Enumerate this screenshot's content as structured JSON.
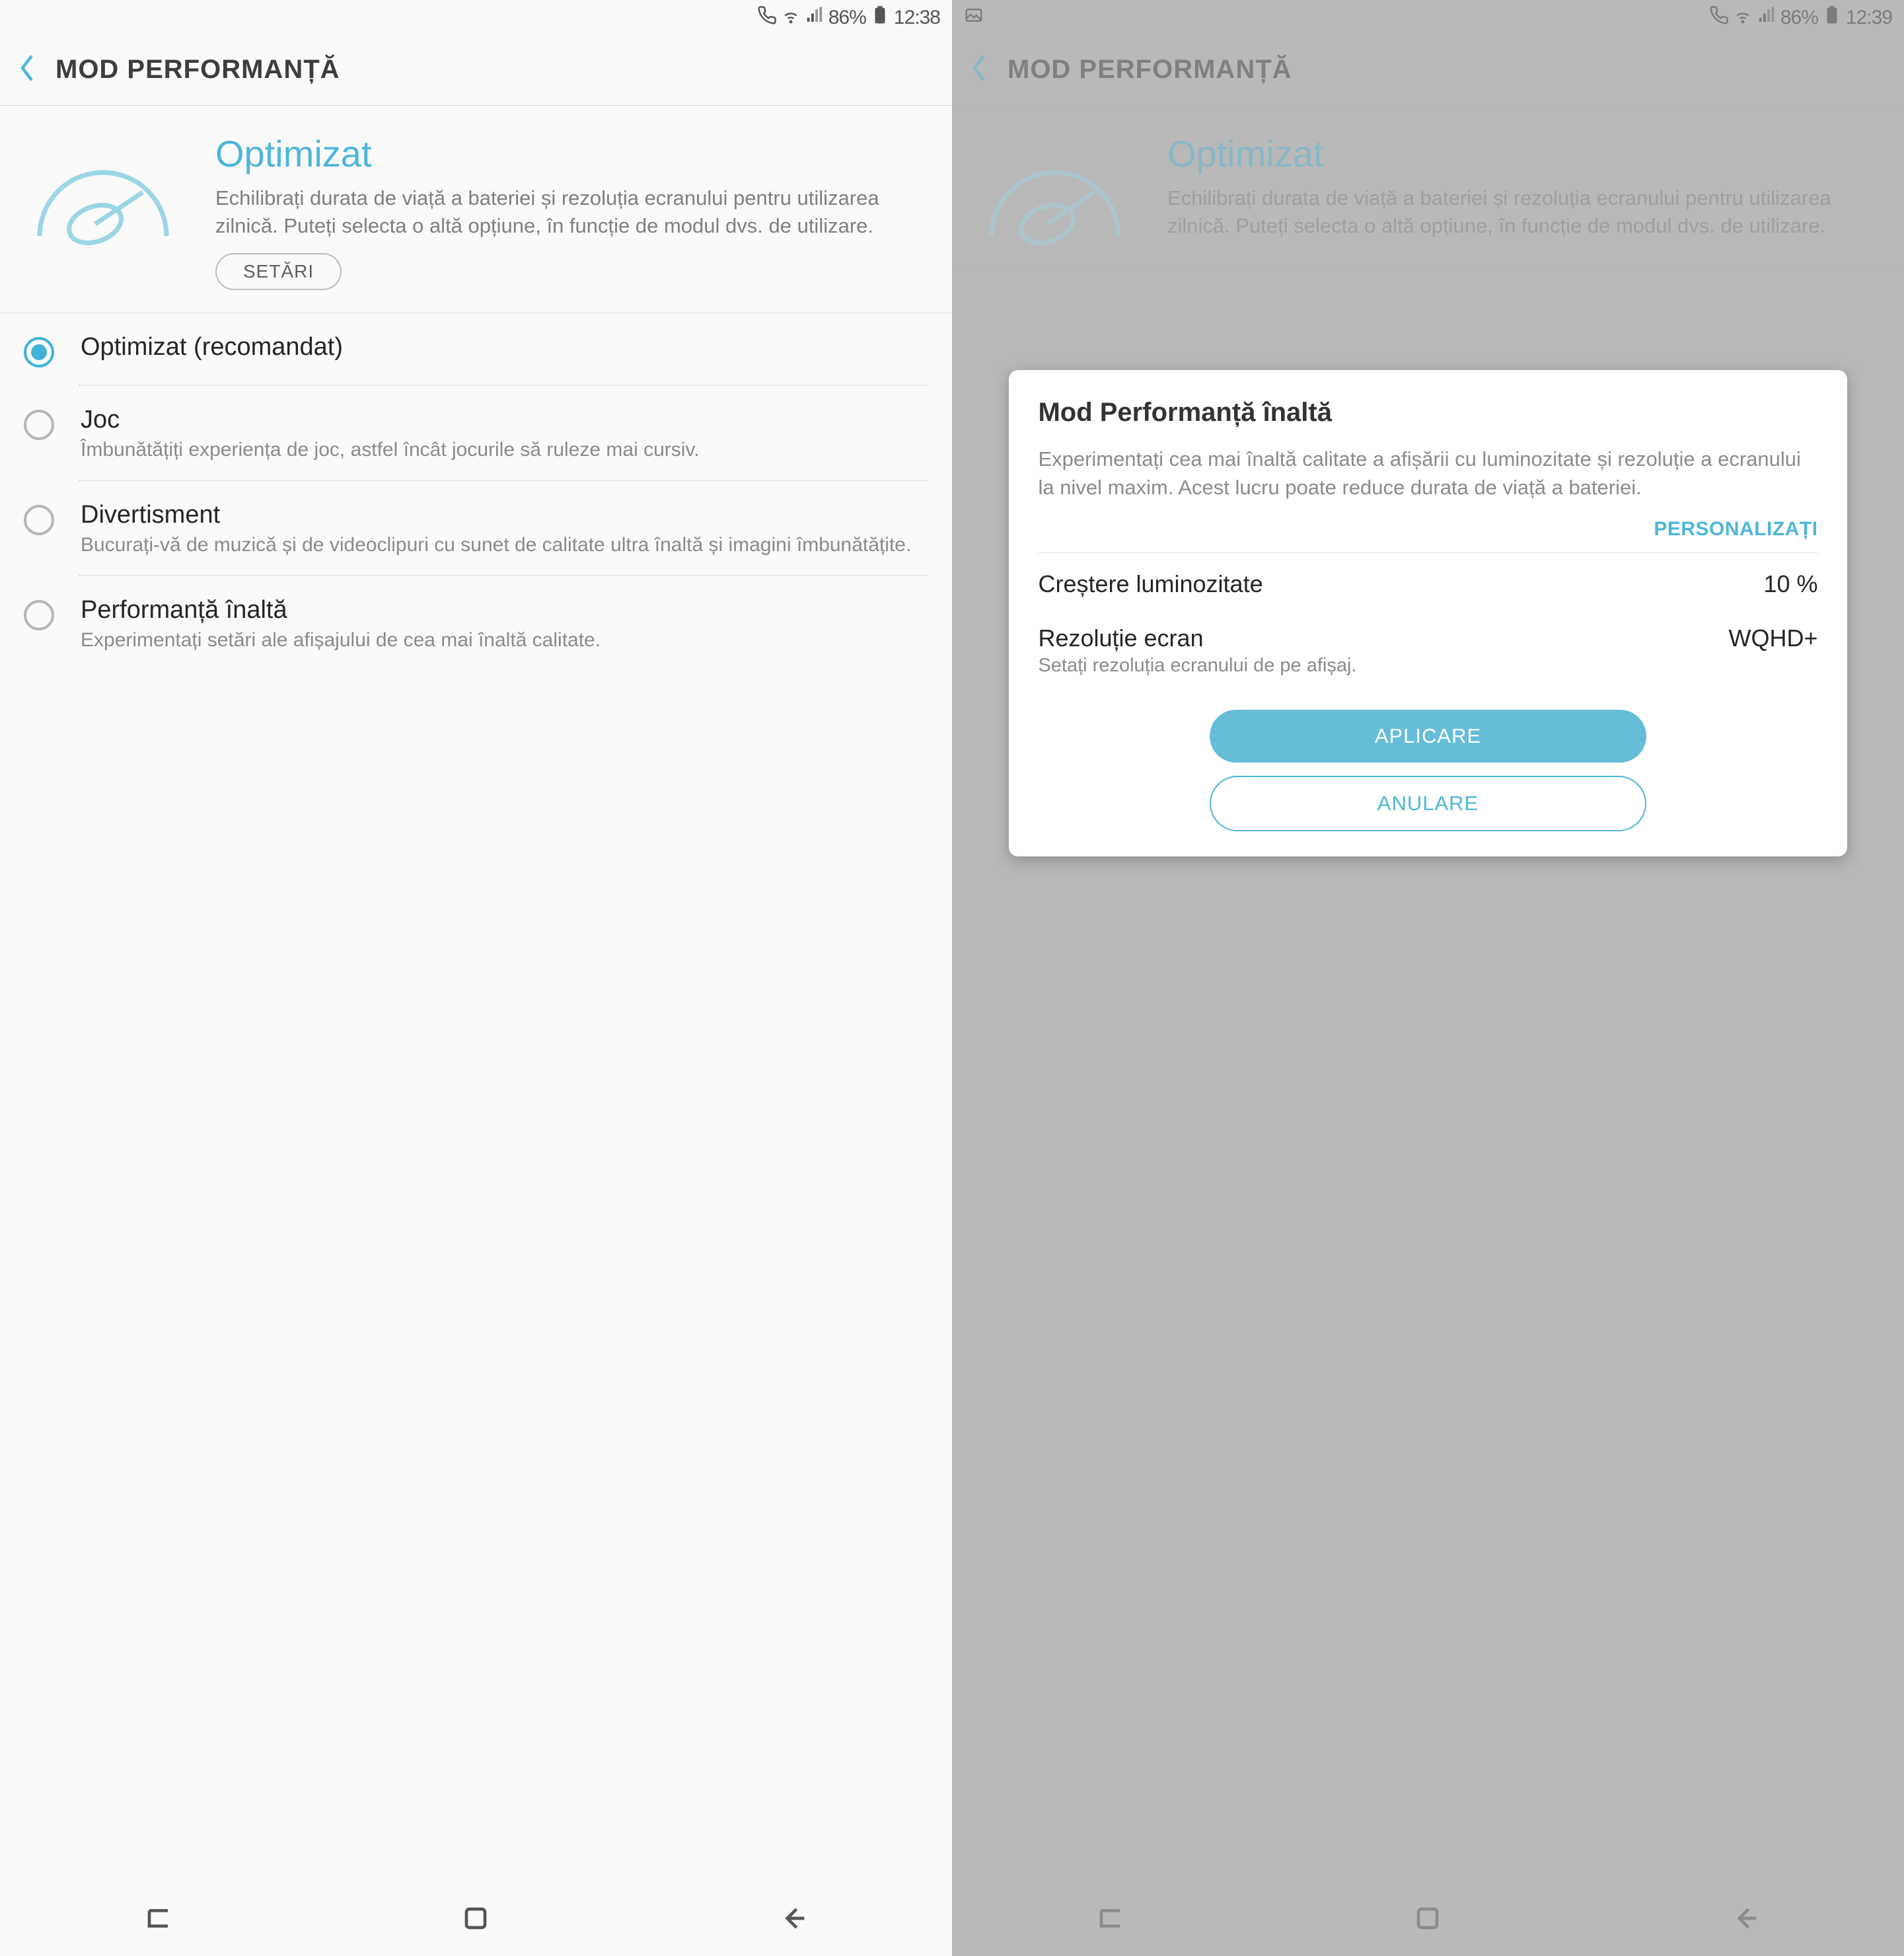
{
  "left": {
    "status": {
      "battery": "86%",
      "time": "12:38"
    },
    "header": {
      "title": "MOD PERFORMANȚĂ"
    },
    "hero": {
      "title": "Optimizat",
      "desc": "Echilibrați durata de viață a bateriei și rezoluția ecranului pentru utilizarea zilnică. Puteți selecta o altă opțiune, în funcție de modul dvs. de utilizare.",
      "settings_btn": "SETĂRI"
    },
    "options": [
      {
        "title": "Optimizat (recomandat)",
        "desc": "",
        "selected": true
      },
      {
        "title": "Joc",
        "desc": "Îmbunătățiți experiența de joc, astfel încât jocurile să ruleze mai cursiv.",
        "selected": false
      },
      {
        "title": "Divertisment",
        "desc": "Bucurați-vă de muzică și de videoclipuri cu sunet de calitate ultra înaltă și imagini îmbunătățite.",
        "selected": false
      },
      {
        "title": "Performanță înaltă",
        "desc": "Experimentați setări ale afișajului de cea mai înaltă calitate.",
        "selected": false
      }
    ]
  },
  "right": {
    "status": {
      "battery": "86%",
      "time": "12:39"
    },
    "header": {
      "title": "MOD PERFORMANȚĂ"
    },
    "hero": {
      "title": "Optimizat",
      "desc": "Echilibrați durata de viață a bateriei și rezoluția ecranului pentru utilizarea zilnică. Puteți selecta o altă opțiune, în funcție de modul dvs. de utilizare."
    },
    "dialog": {
      "title": "Mod Performanță înaltă",
      "desc": "Experimentați cea mai înaltă calitate a afișării cu luminozitate și rezoluție a ecranului la nivel maxim. Acest lucru poate reduce durata de viață a bateriei.",
      "customize": "PERSONALIZAȚI",
      "row1_label": "Creștere luminozitate",
      "row1_value": "10 %",
      "row2_label": "Rezoluție ecran",
      "row2_value": "WQHD+",
      "row2_sub": "Setați rezoluția ecranului de pe afișaj.",
      "apply": "APLICARE",
      "cancel": "ANULARE"
    }
  }
}
